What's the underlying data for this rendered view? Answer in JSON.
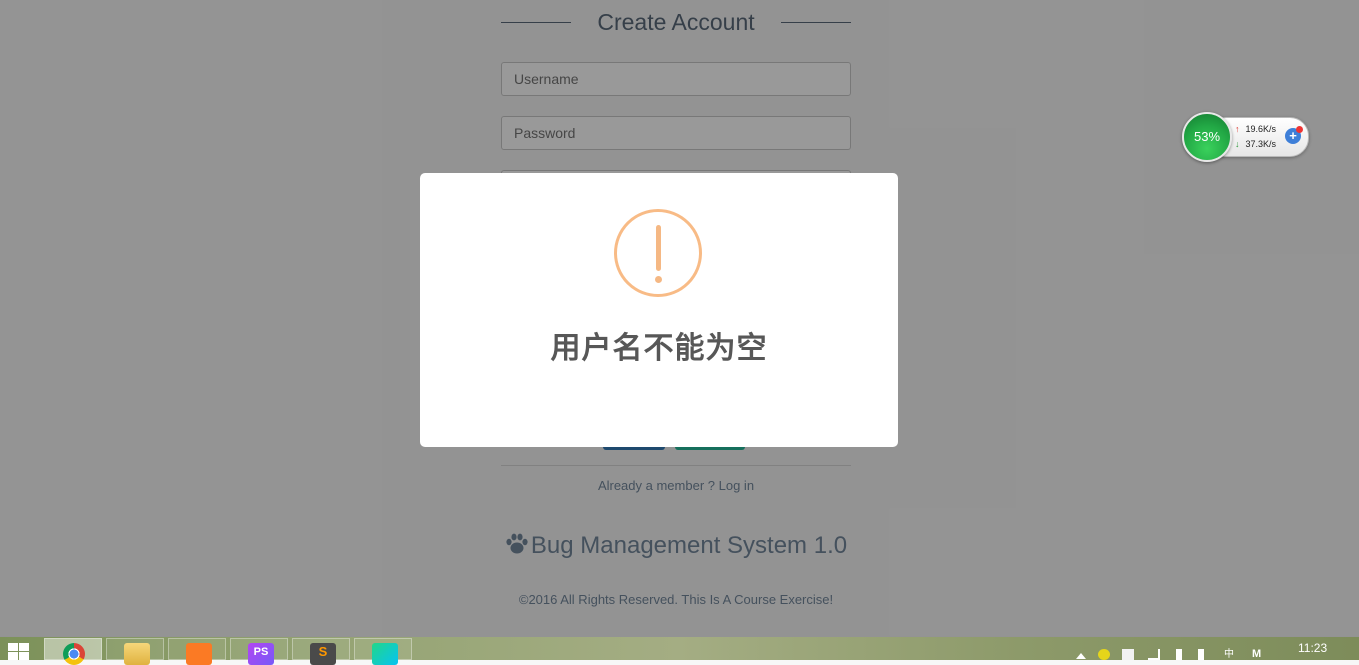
{
  "form": {
    "title": "Create Account",
    "username_placeholder": "Username",
    "password_placeholder": "Password",
    "already_text": "Already a member ?",
    "login_link": "Log in"
  },
  "footer": {
    "brand": "Bug Management System 1.0",
    "copyright": "©2016 All Rights Reserved. This Is A Course Exercise!"
  },
  "alert": {
    "icon": "warning-icon",
    "message": "用户名不能为空",
    "accent_color": "#f8bb86"
  },
  "net_widget": {
    "percent": "53%",
    "upload": "19.6K/s",
    "download": "37.3K/s"
  },
  "taskbar": {
    "apps": [
      "chrome-icon",
      "file-explorer-icon",
      "xampp-icon",
      "phpstorm-icon",
      "sublime-text-icon",
      "webstorm-icon"
    ],
    "active_app": "chrome-icon",
    "clock": "11:23"
  },
  "colors": {
    "text_muted": "#73879c",
    "overlay": "rgba(0,0,0,0.4)",
    "primary_button": "#337ab7",
    "success_button": "#26b99a"
  }
}
